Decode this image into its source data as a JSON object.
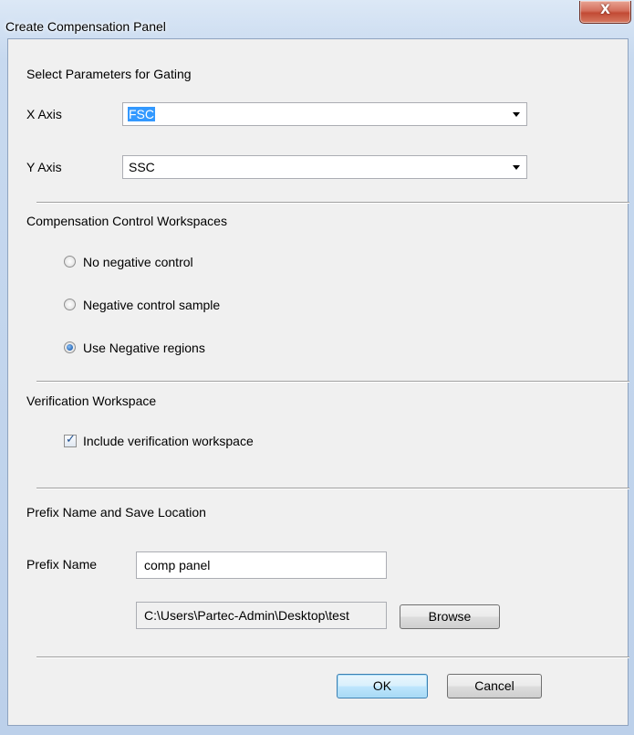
{
  "window": {
    "title": "Create Compensation Panel",
    "close_glyph": "X"
  },
  "gating": {
    "heading": "Select Parameters for Gating",
    "x_axis_label": "X Axis",
    "x_axis_value": "FSC",
    "y_axis_label": "Y Axis",
    "y_axis_value": "SSC"
  },
  "compensation": {
    "heading": "Compensation Control Workspaces",
    "options": [
      {
        "label": "No negative control",
        "selected": false
      },
      {
        "label": "Negative control sample",
        "selected": false
      },
      {
        "label": "Use Negative regions",
        "selected": true
      }
    ]
  },
  "verification": {
    "heading": "Verification Workspace",
    "checkbox_label": "Include verification workspace",
    "checked": true,
    "check_glyph": "✓"
  },
  "save": {
    "heading": "Prefix Name and Save Location",
    "prefix_label": "Prefix Name",
    "prefix_value": "comp panel",
    "location_value": "C:\\Users\\Partec-Admin\\Desktop\\test",
    "browse_label": "Browse"
  },
  "footer": {
    "ok_label": "OK",
    "cancel_label": "Cancel"
  },
  "icons": {
    "close": "close-icon",
    "dropdown": "chevron-down-icon",
    "radio": "radio-icon",
    "checkbox": "checkbox-icon"
  },
  "colors": {
    "dialog_background": "#f0f0f0",
    "titlebar": "#c7d9ef",
    "close_button": "#c24a34",
    "selection_highlight": "#3399ff",
    "default_button_border": "#3c7fb1"
  }
}
